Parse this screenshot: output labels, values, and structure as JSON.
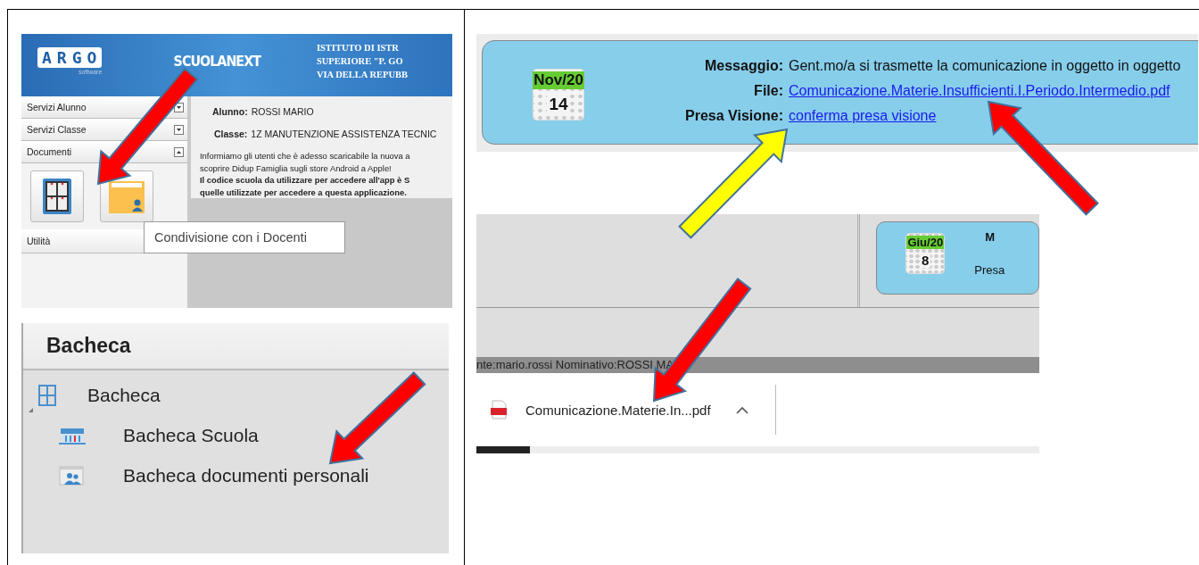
{
  "school_portal": {
    "logo": "ARGO",
    "logo_sub": "software",
    "brand": "SCUOLANEXT",
    "school_lines": [
      "ISTITUTO DI ISTR",
      "SUPERIORE \"P. GO",
      "VIA DELLA REPUBB"
    ],
    "sidebar": [
      {
        "label": "Servizi Alunno",
        "expanded": false
      },
      {
        "label": "Servizi Classe",
        "expanded": false
      },
      {
        "label": "Documenti",
        "expanded": true
      }
    ],
    "utility_label": "Utilità",
    "student": {
      "label": "Alunno:",
      "value": "ROSSI MARIO"
    },
    "class": {
      "label": "Classe:",
      "value": "1Z MANUTENZIONE ASSISTENZA TECNIC"
    },
    "notice_lines": [
      {
        "text": "Informiamo gli utenti che è adesso scaricabile la nuova a",
        "kind": "plain"
      },
      {
        "text": "scoprire Didup Famiglia sugli store Android a Apple!",
        "kind": "plain"
      },
      {
        "text": "Il codice scuola da utilizzare per accedere all'app è S",
        "kind": "bold"
      },
      {
        "text": "quelle utilizzate per accedere a questa applicazione.",
        "kind": "bold"
      }
    ],
    "tooltip": "Condivisione con i Docenti"
  },
  "bacheca_menu": {
    "title": "Bacheca",
    "tree": [
      {
        "label": "Bacheca",
        "expanded": true,
        "children": [
          {
            "label": "Bacheca Scuola",
            "kind": "school"
          },
          {
            "label": "Bacheca documenti personali",
            "kind": "personal"
          }
        ]
      }
    ]
  },
  "message_card": {
    "date": {
      "month": "Nov/20",
      "day": "14"
    },
    "rows": [
      {
        "label": "Messaggio:",
        "value": "Gent.mo/a si trasmette la comunicazione in oggetto in oggetto",
        "kind": "text"
      },
      {
        "label": "File:",
        "value": "Comunicazione.Materie.Insufficienti.I.Periodo.Intermedio.pdf",
        "kind": "link"
      },
      {
        "label": "Presa Visione:",
        "value": "conferma presa visione",
        "kind": "link"
      }
    ]
  },
  "download_view": {
    "card": {
      "date": {
        "month": "Giu/20",
        "day": "8"
      },
      "labels": [
        "M",
        "Presa"
      ]
    },
    "status_text": "nte:mario.rossi Nominativo:ROSSI MA",
    "file_name": "Comunicazione.Materie.In...pdf"
  },
  "arrows": [
    {
      "color": "#ff0000"
    },
    {
      "color": "#ff0000"
    },
    {
      "color": "#ffff00"
    },
    {
      "color": "#ff0000"
    },
    {
      "color": "#ff0000"
    }
  ]
}
